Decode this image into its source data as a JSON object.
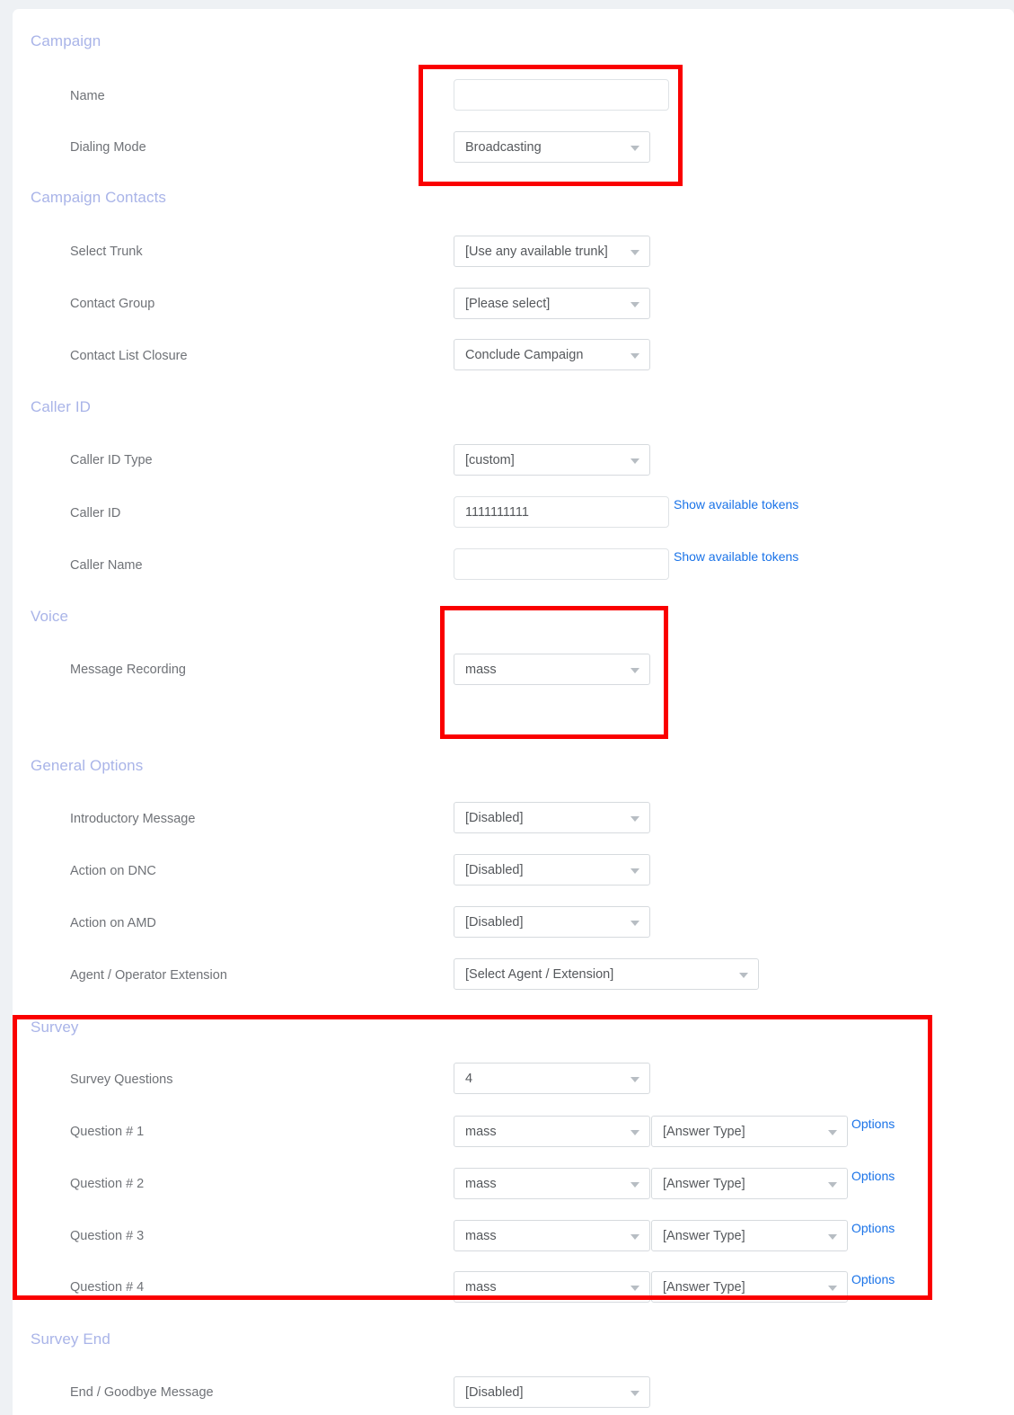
{
  "colors": {
    "page_background": "#eef1f4",
    "card_background": "#ffffff",
    "section_heading": "#a9b4e8",
    "field_label": "#6f7277",
    "control_text": "#55585c",
    "control_border": "#d6dade",
    "link": "#1a73e8",
    "annotation": "#fa0000"
  },
  "sections": [
    {
      "id": "campaign",
      "title": "Campaign",
      "fields": [
        {
          "label": "Name",
          "type": "text",
          "value": "",
          "placeholder": ""
        },
        {
          "label": "Dialing Mode",
          "type": "select",
          "value": "Broadcasting"
        }
      ]
    },
    {
      "id": "campaign-contacts",
      "title": "Campaign Contacts",
      "fields": [
        {
          "label": "Select Trunk",
          "type": "select",
          "value": "[Use any available trunk]"
        },
        {
          "label": "Contact Group",
          "type": "select",
          "value": "[Please select]"
        },
        {
          "label": "Contact List Closure",
          "type": "select",
          "value": "Conclude Campaign"
        }
      ]
    },
    {
      "id": "caller-id",
      "title": "Caller ID",
      "fields": [
        {
          "label": "Caller ID Type",
          "type": "select",
          "value": "[custom]"
        },
        {
          "label": "Caller ID",
          "type": "text",
          "value": "1111111111",
          "link": "Show available tokens"
        },
        {
          "label": "Caller Name",
          "type": "text",
          "value": "",
          "link": "Show available tokens"
        }
      ]
    },
    {
      "id": "voice",
      "title": "Voice",
      "fields": [
        {
          "label": "Message Recording",
          "type": "select",
          "value": "mass"
        }
      ]
    },
    {
      "id": "general-options",
      "title": "General Options",
      "fields": [
        {
          "label": "Introductory Message",
          "type": "select",
          "value": "[Disabled]"
        },
        {
          "label": "Action on DNC",
          "type": "select",
          "value": "[Disabled]"
        },
        {
          "label": "Action on AMD",
          "type": "select",
          "value": "[Disabled]"
        },
        {
          "label": "Agent / Operator Extension",
          "type": "select",
          "value": "[Select Agent / Extension]"
        }
      ]
    },
    {
      "id": "survey",
      "title": "Survey",
      "fields": [
        {
          "label": "Survey Questions",
          "type": "select",
          "value": "4"
        }
      ],
      "questions": [
        {
          "label": "Question # 1",
          "recording": "mass",
          "answer_type": "[Answer Type]",
          "options_link": "Options"
        },
        {
          "label": "Question # 2",
          "recording": "mass",
          "answer_type": "[Answer Type]",
          "options_link": "Options"
        },
        {
          "label": "Question # 3",
          "recording": "mass",
          "answer_type": "[Answer Type]",
          "options_link": "Options"
        },
        {
          "label": "Question # 4",
          "recording": "mass",
          "answer_type": "[Answer Type]",
          "options_link": "Options"
        }
      ]
    },
    {
      "id": "survey-end",
      "title": "Survey End",
      "fields": [
        {
          "label": "End / Goodbye Message",
          "type": "select",
          "value": "[Disabled]"
        }
      ]
    }
  ],
  "annotations": [
    {
      "name": "campaign-highlight",
      "target": "Campaign name and dialing mode"
    },
    {
      "name": "voice-highlight",
      "target": "Message Recording"
    },
    {
      "name": "survey-highlight",
      "target": "Survey section"
    }
  ]
}
